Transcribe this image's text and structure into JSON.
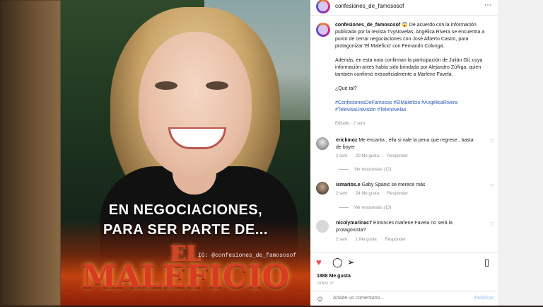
{
  "image": {
    "headline_line1": "EN NEGOCIACIONES,",
    "headline_line2": "PARA SER PARTE DE...",
    "title_el": "EL",
    "title_maleficio": "MALEFICIO",
    "watermark": "IG: @confesiones_de_famososof"
  },
  "post": {
    "header_username": "confesiones_de_famososof",
    "more_icon": "more-icon",
    "caption_username": "confesiones_de_famososof",
    "caption_p1": "😱 De acuerdo con la información publicada por la revista TvyNovelas, Angélica Rivera se encuentra a punto de cerrar negociaciones con José Alberto Castro, para protagonizar 'El Maleficio' con Fernando Colunga.",
    "caption_p2": "Además, en esta nota confirman la participación de Julián Gil, cuya información antes había sido brindada por Alejandro Zúñiga, quien también confirmó extraoficialmente a Marlene Favela.",
    "caption_p3": "¿Qué tal?",
    "hashtags": "#ConfesionesDeFamosos #ElMaleficio #AngélicaRivera #TelevisaUnivisión #Telenovelas",
    "edited": "Editado · 2 sem"
  },
  "comments": [
    {
      "username": "erickmoz",
      "text": "Me encanta , ella si vale la pena que regrese , basta de boyer",
      "time": "2 sem",
      "likes": "20 Me gusta",
      "reply": "Responder",
      "view_replies": "Ver respuestas (12)"
    },
    {
      "username": "ismarios.e",
      "text": "Gaby Spanic se merece más",
      "time": "2 sem",
      "likes": "24 Me gusta",
      "reply": "Responder",
      "view_replies": "Ver respuestas (13)"
    },
    {
      "username": "nicolymarinac7",
      "text": "Entonces marlene Favela no será la protagonista?",
      "time": "2 sem",
      "likes": "1 Me gusta",
      "reply": "Responder"
    }
  ],
  "footer": {
    "likes": "1888 Me gusta",
    "date": "JUNIO 27",
    "comment_placeholder": "Añade un comentario...",
    "post_label": "Publicar"
  },
  "colors": {
    "like_red": "#ed4956",
    "link_blue": "#2b56b5",
    "post_button_disabled": "#b3cdf7"
  }
}
